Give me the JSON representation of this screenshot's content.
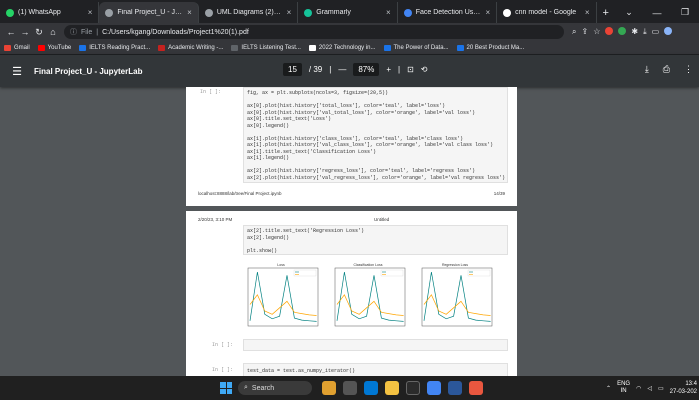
{
  "tabs": [
    {
      "label": "(1) WhatsApp",
      "color": "#25d366",
      "active": false
    },
    {
      "label": "Final Project_U - Jupyt",
      "color": "#9aa0a6",
      "active": true
    },
    {
      "label": "UML Diagrams (2).pdf",
      "color": "#9aa0a6",
      "active": false
    },
    {
      "label": "Grammarly",
      "color": "#15c39a",
      "active": false
    },
    {
      "label": "Face Detection Using",
      "color": "#4285f4",
      "active": false
    },
    {
      "label": "cnn model - Google",
      "color": "#ffffff",
      "active": false
    }
  ],
  "address": {
    "prefix": "File",
    "url": "C:/Users/kgang/Downloads/Project1%20(1).pdf"
  },
  "bookmarks": [
    {
      "label": "Gmail",
      "color": "#ea4335"
    },
    {
      "label": "YouTube",
      "color": "#ff0000"
    },
    {
      "label": "IELTS Reading Pract...",
      "color": "#1a73e8"
    },
    {
      "label": "Academic Writing -...",
      "color": "#c5221f"
    },
    {
      "label": "IELTS Listening Test...",
      "color": "#5f6368"
    },
    {
      "label": "2022 Technology in...",
      "color": "#ffffff"
    },
    {
      "label": "The Power of Data...",
      "color": "#1a73e8"
    },
    {
      "label": "20 Best Product Ma...",
      "color": "#1a73e8"
    }
  ],
  "pdf": {
    "title": "Final Project_U - JupyterLab",
    "page_current": "15",
    "page_total": "/ 39",
    "zoom": "87%"
  },
  "page1": {
    "prompt": "In [ ]:",
    "code": [
      "fig, ax = plt.subplots(ncols=3, figsize=(20,5))",
      "",
      "ax[0].plot(hist.history['total_loss'], color='teal', label='loss')",
      "ax[0].plot(hist.history['val_total_loss'], color='orange', label='val loss')",
      "ax[0].title.set_text('Loss')",
      "ax[0].legend()",
      "",
      "ax[1].plot(hist.history['class_loss'], color='teal', label='class loss')",
      "ax[1].plot(hist.history['val_class_loss'], color='orange', label='val class loss')",
      "ax[1].title.set_text('Classification Loss')",
      "ax[1].legend()",
      "",
      "ax[2].plot(hist.history['regress_loss'], color='teal', label='regress loss')",
      "ax[2].plot(hist.history['val_regress_loss'], color='orange', label='val regress loss')"
    ],
    "footer_left": "localhost:8888/lab/tree/Final Project.ipynb",
    "footer_right": "14/39"
  },
  "page2": {
    "header_left": "2/20/23, 3:10 PM",
    "header_center": "Untitled",
    "code": [
      "ax[2].title.set_text('Regression Loss')",
      "ax[2].legend()",
      "",
      "plt.show()"
    ],
    "plot_titles": [
      "Loss",
      "Classification Loss",
      "Regression Loss"
    ],
    "prompt_empty": "In [ ]:",
    "prompt_next": "In [ ]:",
    "code_next": "test_data = test.as_numpy_iterator()"
  },
  "taskbar": {
    "search": "Search",
    "lang": "ENG",
    "lang2": "IN",
    "time": "13:4",
    "date": "27-03-202"
  },
  "colors": {
    "series_train": "#008080",
    "series_val": "#ffa500"
  }
}
